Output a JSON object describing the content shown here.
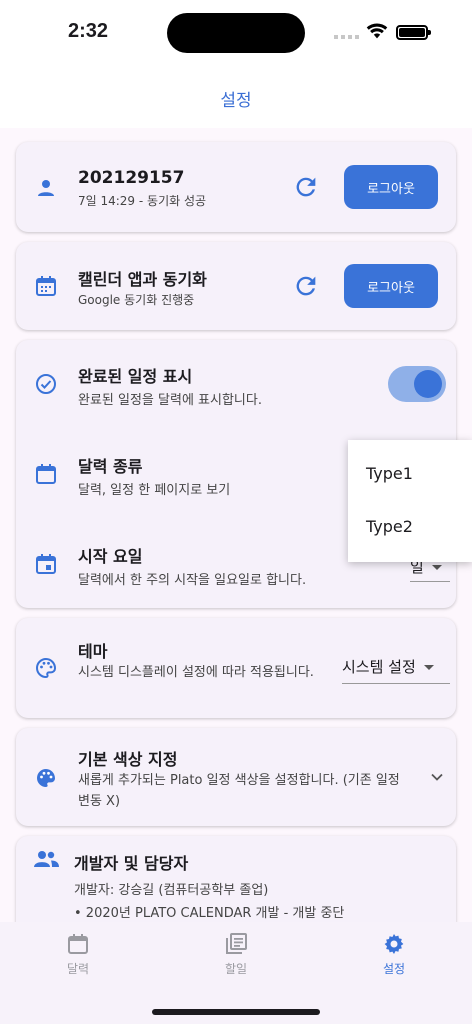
{
  "status": {
    "time": "2:32"
  },
  "app": {
    "title": "설정"
  },
  "account": {
    "id": "202129157",
    "sync_status": "7일 14:29 - 동기화 성공",
    "logout_label": "로그아웃"
  },
  "calendar_sync": {
    "title": "캘린더 앱과 동기화",
    "status": "Google 동기화 진행중",
    "logout_label": "로그아웃"
  },
  "settings": {
    "show_completed": {
      "title": "완료된 일정 표시",
      "desc": "완료된 일정을 달력에 표시합니다.",
      "enabled": true
    },
    "calendar_type": {
      "title": "달력 종류",
      "desc": "달력, 일정 한 페이지로 보기"
    },
    "start_day": {
      "title": "시작 요일",
      "desc": "달력에서 한 주의 시작을 일요일로 합니다.",
      "value": "일"
    },
    "theme": {
      "title": "테마",
      "desc": "시스템 디스플레이 설정에 따라 적용됩니다.",
      "value": "시스템 설정"
    },
    "default_color": {
      "title": "기본 색상 지정",
      "desc": "새롭게 추가되는 Plato 일정 색상을 설정합니다. (기존 일정 변동 X)"
    },
    "developer": {
      "title": "개발자 및 담당자",
      "line1": "개발자: 강승길  (컴퓨터공학부 졸업)",
      "line2": "• 2020년 PLATO CALENDAR 개발 - 개발 중단"
    }
  },
  "dropdown": {
    "options": [
      "Type1",
      "Type2"
    ]
  },
  "nav": {
    "items": [
      {
        "label": "달력"
      },
      {
        "label": "할일"
      },
      {
        "label": "설정"
      }
    ]
  },
  "colors": {
    "accent": "#3a73d8",
    "background": "#fdf7fd",
    "card": "#f6f1fa"
  }
}
